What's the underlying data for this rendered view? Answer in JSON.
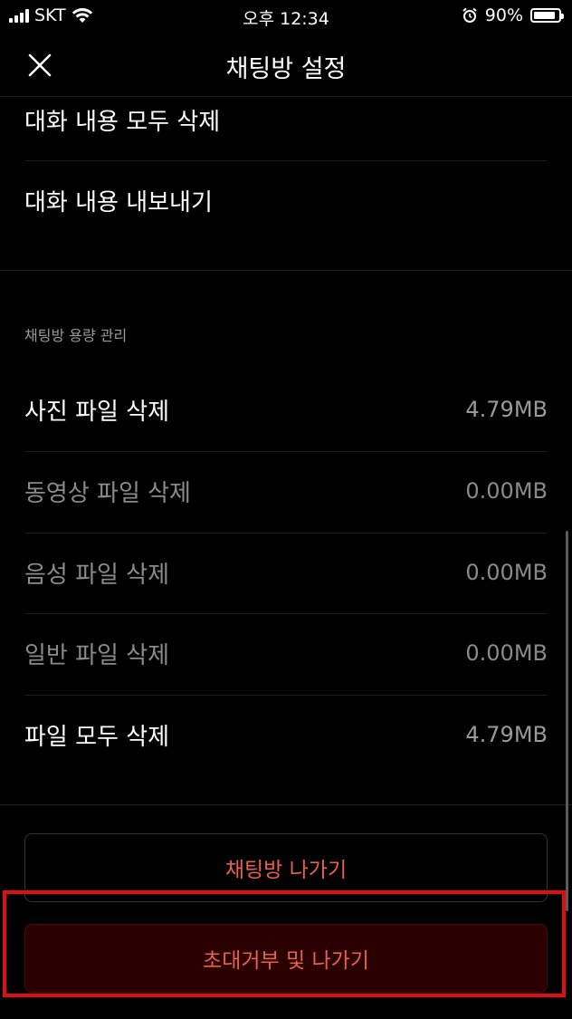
{
  "status_bar": {
    "carrier": "SKT",
    "time": "오후 12:34",
    "battery_percent": "90%",
    "battery_level": 0.9
  },
  "header": {
    "title": "채팅방 설정",
    "close_icon": "close-icon"
  },
  "top_rows": [
    {
      "label": "대화 내용 모두 삭제"
    },
    {
      "label": "대화 내용 내보내기"
    }
  ],
  "storage": {
    "section_label": "채팅방 용량 관리",
    "rows": [
      {
        "label": "사진 파일 삭제",
        "value": "4.79MB"
      },
      {
        "label": "동영상 파일 삭제",
        "value": "0.00MB"
      },
      {
        "label": "음성 파일 삭제",
        "value": "0.00MB"
      },
      {
        "label": "일반 파일 삭제",
        "value": "0.00MB"
      },
      {
        "label": "파일 모두 삭제",
        "value": "4.79MB"
      }
    ]
  },
  "buttons": {
    "leave": "채팅방 나가기",
    "reject_and_leave": "초대거부 및 나가기"
  },
  "colors": {
    "background": "#000000",
    "accent_red": "#e8604c",
    "highlight": "#e00e0e"
  }
}
